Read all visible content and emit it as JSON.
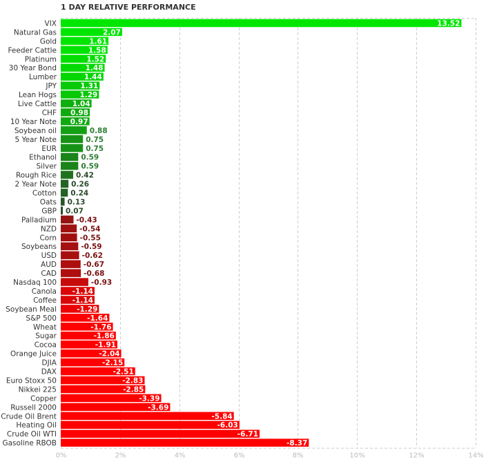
{
  "chart_data": {
    "type": "bar",
    "orientation": "horizontal",
    "title": "1 DAY RELATIVE PERFORMANCE",
    "xlabel": "",
    "ylabel": "",
    "value_type": "absolute percent change (bar length), signed value shown as label",
    "xlim": [
      0,
      14
    ],
    "x_ticks": [
      "0%",
      "2%",
      "4%",
      "6%",
      "8%",
      "10%",
      "12%",
      "14%"
    ],
    "grid": true,
    "legend": "none",
    "categories": [
      "VIX",
      "Natural Gas",
      "Gold",
      "Feeder Cattle",
      "Platinum",
      "30 Year Bond",
      "Lumber",
      "JPY",
      "Lean Hogs",
      "Live Cattle",
      "CHF",
      "10 Year Note",
      "Soybean oil",
      "5 Year Note",
      "EUR",
      "Ethanol",
      "Silver",
      "Rough Rice",
      "2 Year Note",
      "Cotton",
      "Oats",
      "GBP",
      "Palladium",
      "NZD",
      "Corn",
      "Soybeans",
      "USD",
      "AUD",
      "CAD",
      "Nasdaq 100",
      "Canola",
      "Coffee",
      "Soybean Meal",
      "S&P 500",
      "Wheat",
      "Sugar",
      "Cocoa",
      "Orange Juice",
      "DJIA",
      "DAX",
      "Euro Stoxx 50",
      "Nikkei 225",
      "Copper",
      "Russell 2000",
      "Crude Oil Brent",
      "Heating Oil",
      "Crude Oil WTI",
      "Gasoline RBOB"
    ],
    "values": [
      13.52,
      2.07,
      1.61,
      1.58,
      1.52,
      1.48,
      1.44,
      1.31,
      1.29,
      1.04,
      0.98,
      0.97,
      0.88,
      0.75,
      0.75,
      0.59,
      0.59,
      0.42,
      0.26,
      0.24,
      0.13,
      0.07,
      -0.43,
      -0.54,
      -0.55,
      -0.59,
      -0.62,
      -0.67,
      -0.68,
      -0.93,
      -1.14,
      -1.14,
      -1.29,
      -1.64,
      -1.76,
      -1.86,
      -1.91,
      -2.04,
      -2.15,
      -2.51,
      -2.83,
      -2.85,
      -3.39,
      -3.69,
      -5.84,
      -6.03,
      -6.71,
      -8.37
    ],
    "colors": {
      "positive_strong": "#00e600",
      "positive_weak": "#2a4a2a",
      "negative_weak": "#6b1a1a",
      "negative_strong": "#ff0000",
      "label_inside": "#ffffff",
      "label_outside_pos": "#2e7d32",
      "label_outside_neg": "#7a1010",
      "grid": "#cccccc",
      "tick_text": "#bbbbbb"
    }
  }
}
